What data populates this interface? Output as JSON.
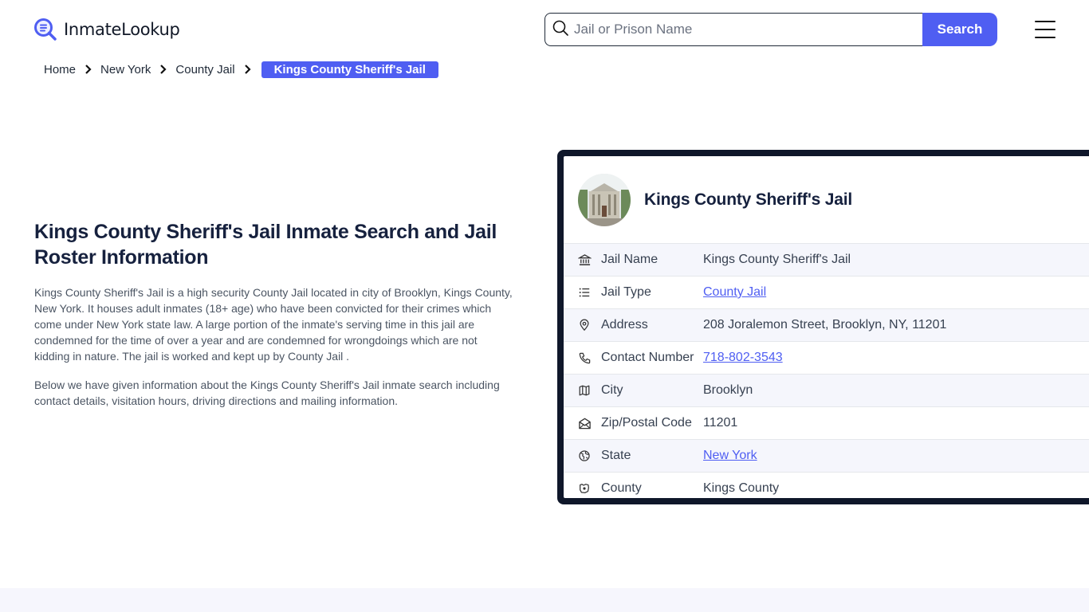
{
  "header": {
    "logo_text": "InmateLookup",
    "logo_icon": "magnifier-list-icon",
    "search_placeholder": "Jail or Prison Name",
    "search_value": "",
    "search_button": "Search",
    "menu_icon": "hamburger-menu-icon"
  },
  "breadcrumb": {
    "items": [
      "Home",
      "New York",
      "County Jail"
    ],
    "current": "Kings County Sheriff's Jail"
  },
  "intro": {
    "title": "Kings County Sheriff's Jail Inmate Search and Jail Roster Information",
    "paragraph1": "Kings County Sheriff's Jail is a high security County Jail located in city of Brooklyn, Kings County, New York. It houses adult inmates (18+ age) who have been convicted for their crimes which come under New York state law. A large portion of the inmate's serving time in this jail are condemned for the time of over a year and are condemned for wrongdoings which are not kidding in nature. The jail is worked and kept up by County Jail .",
    "paragraph2": "Below we have given information about the Kings County Sheriff's Jail inmate search including contact details, visitation hours, driving directions and mailing information."
  },
  "card": {
    "title": "Kings County Sheriff's Jail",
    "rows": [
      {
        "icon": "building-icon",
        "label": "Jail Name",
        "value": "Kings County Sheriff's Jail",
        "link": false
      },
      {
        "icon": "list-icon",
        "label": "Jail Type",
        "value": "County Jail",
        "link": true
      },
      {
        "icon": "map-pin-icon",
        "label": "Address",
        "value": "208 Joralemon Street, Brooklyn, NY, 11201",
        "link": false
      },
      {
        "icon": "phone-icon",
        "label": "Contact Number",
        "value": "718-802-3543",
        "link": true
      },
      {
        "icon": "map-icon",
        "label": "City",
        "value": "Brooklyn",
        "link": false
      },
      {
        "icon": "mail-open-icon",
        "label": "Zip/Postal Code",
        "value": "11201",
        "link": false
      },
      {
        "icon": "globe-icon",
        "label": "State",
        "value": "New York",
        "link": true
      },
      {
        "icon": "county-icon",
        "label": "County",
        "value": "Kings County",
        "link": false
      }
    ]
  },
  "colors": {
    "accent": "#4f5ef2",
    "card_border": "#0f172a",
    "heading": "#16213e",
    "row_alt": "#f5f6fc",
    "footer_band": "#f6f6fd"
  }
}
